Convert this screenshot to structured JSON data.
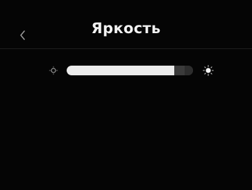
{
  "header": {
    "title": "Яркость",
    "back_icon": "chevron-left-icon"
  },
  "brightness": {
    "level_fraction": 0.85,
    "min_icon": "sun-dim-icon",
    "max_icon": "sun-bright-icon"
  },
  "colors": {
    "background": "#050505",
    "track_fill": "#ececec",
    "track_empty": "#3b3b3b",
    "text": "#f2f2f2"
  }
}
